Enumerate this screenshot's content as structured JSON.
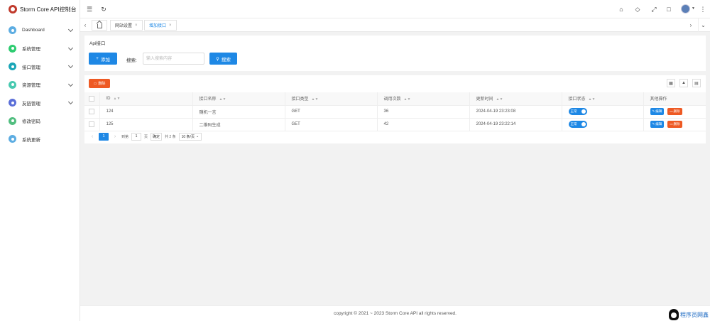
{
  "app": {
    "title": "Storm Core API控制台"
  },
  "sidebar": {
    "items": [
      {
        "label": "Dashboard",
        "icon": "dashboard-icon",
        "color": "#5dade2",
        "expandable": true
      },
      {
        "label": "系统管理",
        "icon": "settings-icon",
        "color": "#2ecc71",
        "expandable": true
      },
      {
        "label": "接口管理",
        "icon": "api-icon",
        "color": "#1abc9c",
        "expandable": true
      },
      {
        "label": "资源管理",
        "icon": "resource-icon",
        "color": "#48c9b0",
        "expandable": true
      },
      {
        "label": "友链管理",
        "icon": "link-icon",
        "color": "#5b6fd8",
        "expandable": true
      },
      {
        "label": "修改密码",
        "icon": "password-icon",
        "color": "#52be80",
        "expandable": false
      },
      {
        "label": "系统更新",
        "icon": "update-icon",
        "color": "#5dade2",
        "expandable": false
      }
    ]
  },
  "tabs": [
    {
      "label": "网站设置",
      "active": false
    },
    {
      "label": "增加接口",
      "active": true
    }
  ],
  "search_card": {
    "title": "Api接口",
    "add_label": "添加",
    "search_label": "搜索:",
    "search_placeholder": "输入搜索内容",
    "search_button": "搜索"
  },
  "table": {
    "delete_label": "删除",
    "columns": [
      "ID",
      "接口名称",
      "接口类型",
      "调用次数",
      "更新时间",
      "接口状态",
      "其他操作"
    ],
    "rows": [
      {
        "id": "124",
        "name": "随机一言",
        "type": "GET",
        "calls": "36",
        "updated": "2024-04-19 23:23:08",
        "status": "正常"
      },
      {
        "id": "125",
        "name": "二维码生成",
        "type": "GET",
        "calls": "42",
        "updated": "2024-04-19 23:22:14",
        "status": "正常"
      }
    ],
    "edit_label": "编辑",
    "row_delete_label": "删除"
  },
  "pager": {
    "current": "1",
    "goto_label": "到第",
    "goto_value": "1",
    "page_unit": "页",
    "confirm": "确定",
    "total": "共 2 条",
    "page_size": "10 条/页"
  },
  "footer": {
    "text": "copyright © 2021 ~ 2023 Storm Core API all rights reserved."
  },
  "watermark": {
    "text": "程序员网鑫"
  },
  "colors": {
    "primary": "#1e88e5",
    "danger": "#ee5a24"
  }
}
